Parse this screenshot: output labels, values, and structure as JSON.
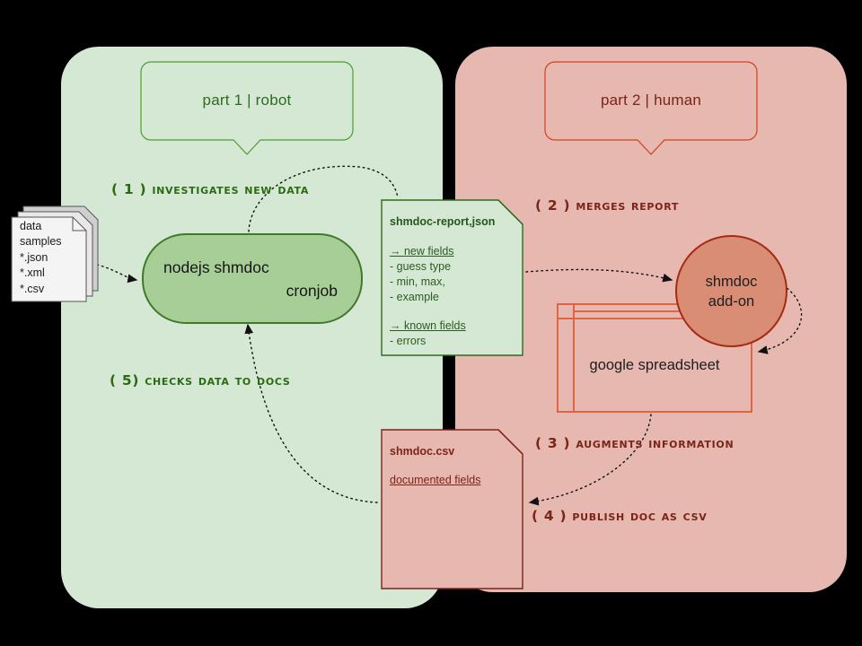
{
  "diagram": {
    "title": "shmdoc workflow",
    "colors": {
      "robot_panel": "#d5e8d4",
      "human_panel": "#e6b8b0",
      "green_stroke": "#3e7a28",
      "green_text": "#2b6a12",
      "red_stroke": "#a52a12",
      "red_text": "#7b2418",
      "node_fill": "#a8ce97",
      "circle_fill": "#d98d75",
      "table_stroke": "#e06545",
      "background": "#000000"
    }
  },
  "panels": {
    "robot": {
      "title": "part 1 | robot"
    },
    "human": {
      "title": "part 2 | human"
    }
  },
  "steps": [
    {
      "id": "step1",
      "label": "( 1 ) investigates new data",
      "color": "green"
    },
    {
      "id": "step5",
      "label": "( 5) checks data to docs",
      "color": "green"
    },
    {
      "id": "step2",
      "label": "( 2 ) merges report",
      "color": "red"
    },
    {
      "id": "step3",
      "label": "( 3 ) augments information",
      "color": "red"
    },
    {
      "id": "step4",
      "label": "( 4 ) publish doc as csv",
      "color": "red"
    }
  ],
  "nodes": {
    "data_samples": {
      "lines": "data\nsamples\n*.json\n*.xml\n*.csv"
    },
    "shmdoc_runner": {
      "line1": "nodejs shmdoc",
      "line2": "cronjob"
    },
    "report_note": {
      "title": "shmdoc-report,json",
      "section1_header": "→ new fields",
      "section1_items": "- guess type\n- min, max,\n- example",
      "section2_header": "→ known fields",
      "section2_items": "- errors"
    },
    "csv_note": {
      "title": "shmdoc.csv",
      "subtitle": "documented fields"
    },
    "spreadsheet": {
      "label": "google spreadsheet"
    },
    "addon": {
      "line1": "shmdoc",
      "line2": "add-on"
    }
  }
}
